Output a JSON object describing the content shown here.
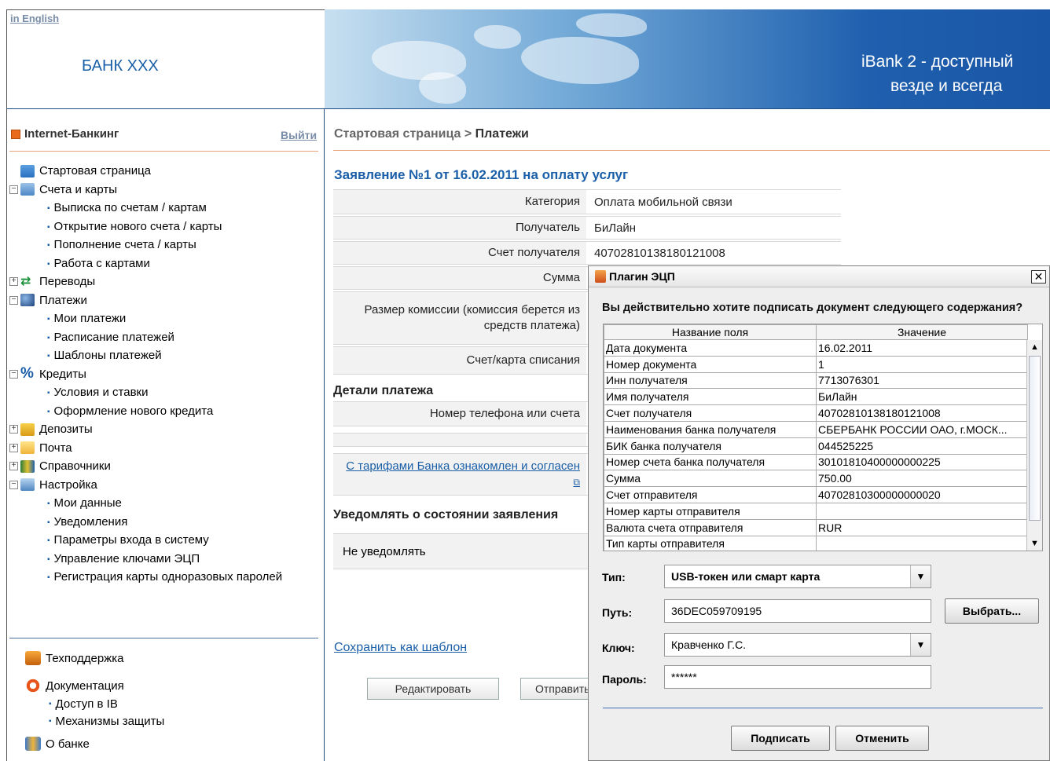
{
  "header": {
    "lang_link": "in English",
    "bank_name": "БАНК XXX",
    "slogan_line1": "iBank 2  - доступный",
    "slogan_line2": "везде и всегда"
  },
  "sidebar": {
    "title": "Internet-Банкинг",
    "logout": "Выйти",
    "items": [
      {
        "label": "Стартовая страница",
        "icon": "monitor-icon",
        "level": 0,
        "toggle": ""
      },
      {
        "label": "Счета и карты",
        "icon": "card-icon",
        "level": 0,
        "toggle": "⊟"
      },
      {
        "label": "Выписка по счетам / картам",
        "level": 1
      },
      {
        "label": "Открытие нового счета / карты",
        "level": 1
      },
      {
        "label": "Пополнение счета / карты",
        "level": 1
      },
      {
        "label": "Работа с картами",
        "level": 1
      },
      {
        "label": "Переводы",
        "icon": "arrows-icon",
        "level": 0,
        "toggle": "⊞"
      },
      {
        "label": "Платежи",
        "icon": "globe-icon",
        "level": 0,
        "toggle": "⊟"
      },
      {
        "label": "Мои платежи",
        "level": 1
      },
      {
        "label": "Расписание платежей",
        "level": 1
      },
      {
        "label": "Шаблоны платежей",
        "level": 1
      },
      {
        "label": "Кредиты",
        "icon": "percent-icon",
        "level": 0,
        "toggle": "⊟"
      },
      {
        "label": "Условия и ставки",
        "level": 1
      },
      {
        "label": "Оформление нового кредита",
        "level": 1
      },
      {
        "label": "Депозиты",
        "icon": "coins-icon",
        "level": 0,
        "toggle": "⊞"
      },
      {
        "label": "Почта",
        "icon": "mail-icon",
        "level": 0,
        "toggle": "⊞"
      },
      {
        "label": "Справочники",
        "icon": "books-icon",
        "level": 0,
        "toggle": "⊞"
      },
      {
        "label": "Настройка",
        "icon": "settings-icon",
        "level": 0,
        "toggle": "⊟"
      },
      {
        "label": "Мои данные",
        "level": 1
      },
      {
        "label": "Уведомления",
        "level": 1
      },
      {
        "label": "Параметры входа в систему",
        "level": 1
      },
      {
        "label": "Управление ключами ЭЦП",
        "level": 1
      },
      {
        "label": "Регистрация карты одноразовых паролей",
        "level": 1
      }
    ],
    "bottom": {
      "support": "Техподдержка",
      "docs": "Документация",
      "docs_items": [
        "Доступ в IB",
        "Механизмы защиты"
      ],
      "about": "О банке"
    }
  },
  "main": {
    "breadcrumb_root": "Стартовая страница",
    "breadcrumb_sep": " > ",
    "breadcrumb_current": "Платежи",
    "title": "Заявление №1 от 16.02.2011 на оплату услуг",
    "fields": {
      "category_label": "Категория",
      "category_value": "Оплата мобильной связи",
      "recipient_label": "Получатель",
      "recipient_value": "БиЛайн",
      "account_label": "Счет получателя",
      "account_value": "40702810138180121008",
      "sum_label": "Сумма",
      "commission_label": "Размер комиссии (комиссия берется из средств платежа)",
      "debit_label": "Счет/карта списания"
    },
    "details_header": "Детали платежа",
    "phone_label": "Номер телефона или счета",
    "tariff_link": "С тарифами Банка ознакомлен и согласен",
    "notify_header": "Уведомлять о состоянии заявления",
    "notify_value": "Не уведомлять",
    "save_template": "Сохранить как шаблон",
    "edit_button": "Редактировать",
    "send_button": "Отправить"
  },
  "dialog": {
    "title": "Плагин ЭЦП",
    "question": "Вы действительно хотите подписать документ следующего содержания?",
    "col_field": "Название поля",
    "col_value": "Значение",
    "rows": [
      [
        "Дата документа",
        "16.02.2011"
      ],
      [
        "Номер документа",
        "1"
      ],
      [
        "Инн получателя",
        "7713076301"
      ],
      [
        "Имя получателя",
        "БиЛайн"
      ],
      [
        "Счет получателя",
        "40702810138180121008"
      ],
      [
        "Наименования банка получателя",
        "СБЕРБАНК РОССИИ ОАО, г.МОСК..."
      ],
      [
        "БИК банка получателя",
        "044525225"
      ],
      [
        "Номер счета банка получателя",
        "30101810400000000225"
      ],
      [
        "Сумма",
        "750.00"
      ],
      [
        "Счет отправителя",
        "40702810300000000020"
      ],
      [
        "Номер карты отправителя",
        ""
      ],
      [
        "Валюта счета отправителя",
        "RUR"
      ],
      [
        "Тип карты отправителя",
        ""
      ]
    ],
    "type_label": "Тип:",
    "type_value": "USB-токен или смарт карта",
    "path_label": "Путь:",
    "path_value": "36DEC059709195",
    "choose_button": "Выбрать...",
    "key_label": "Ключ:",
    "key_value": "Кравченко Г.С.",
    "password_label": "Пароль:",
    "password_value": "******",
    "sign_button": "Подписать",
    "cancel_button": "Отменить"
  }
}
